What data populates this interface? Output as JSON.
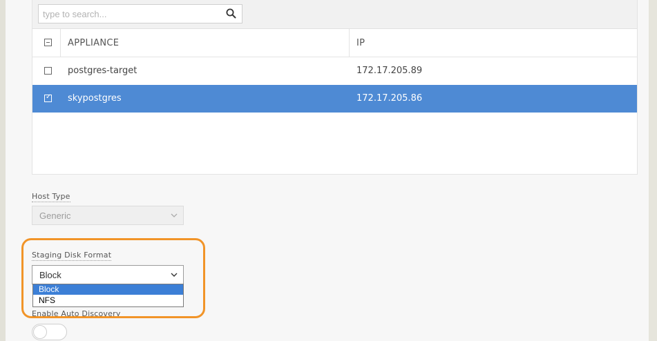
{
  "search": {
    "placeholder": "type to search..."
  },
  "table": {
    "headers": {
      "appliance": "APPLIANCE",
      "ip": "IP"
    },
    "rows": [
      {
        "appliance": "postgres-target",
        "ip": "172.17.205.89",
        "selected": false
      },
      {
        "appliance": "skypostgres",
        "ip": "172.17.205.86",
        "selected": true
      }
    ]
  },
  "host_type": {
    "label": "Host Type",
    "value": "Generic"
  },
  "staging_disk_format": {
    "label": "Staging Disk Format",
    "value": "Block",
    "options": [
      "Block",
      "NFS"
    ]
  },
  "auto_discovery": {
    "label": "Enable Auto Discovery",
    "enabled": false
  },
  "colors": {
    "accent": "#4e8ad4",
    "highlight": "#f19428",
    "option_active": "#3c7fd6"
  }
}
